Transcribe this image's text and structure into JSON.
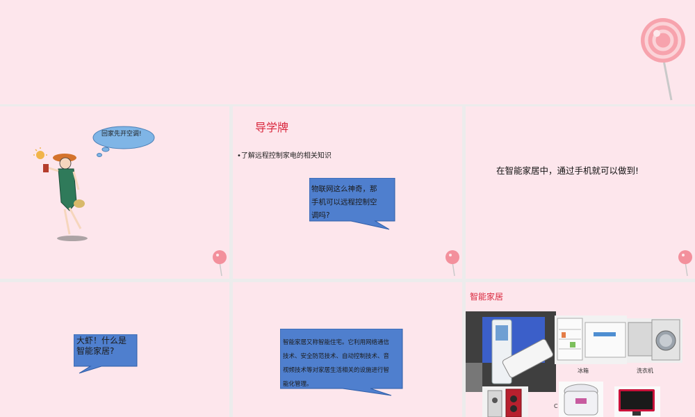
{
  "slides": {
    "s2": {
      "thought": "回家先开空调!"
    },
    "s3": {
      "title": "导学牌",
      "bullet": "•了解远程控制家电的相关知识",
      "callout": [
        "物联网这么神奇，那",
        "手机可以远程控制空",
        "调吗?"
      ]
    },
    "s4": {
      "text": "在智能家居中，通过手机就可以做到!"
    },
    "s5": {
      "callout": [
        "大虾！什么是",
        "智能家居?"
      ]
    },
    "s6": {
      "callout": [
        "智能家居又称智能住宅。它利用网络通信",
        "技术、安全防范技术、自动控制技术、音",
        "视频技术等对家居生活相关的设施进行智",
        "能化管理。"
      ]
    },
    "s7": {
      "title": "智能家居",
      "captions": {
        "fridge": "冰箱",
        "washer": "洗衣机",
        "stray": "C"
      }
    }
  },
  "colors": {
    "slide_bg": "#fde6ec",
    "callout_fill": "#4f7fce",
    "title_red": "#d9263c",
    "lollipop": "#f3909c"
  }
}
